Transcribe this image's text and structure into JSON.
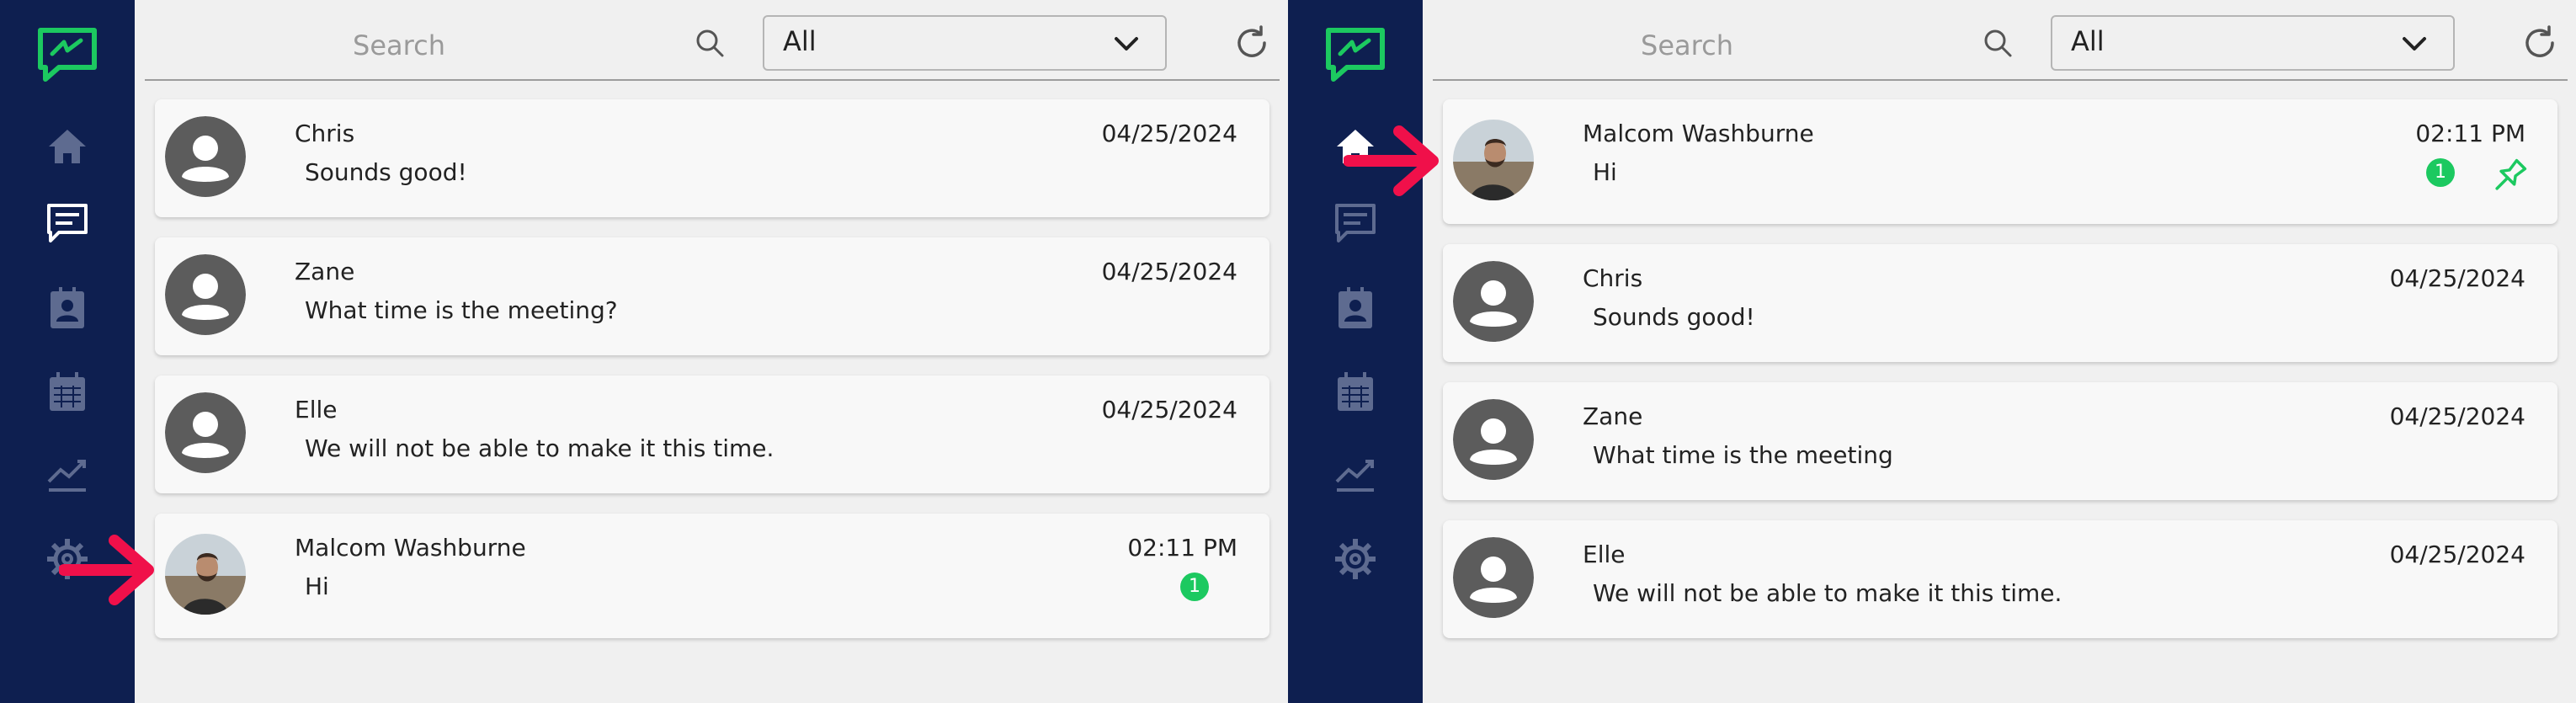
{
  "colors": {
    "sidebar": "#0e1f50",
    "accent_green": "#1cc960",
    "arrow_red": "#f0104a",
    "icon_gray": "#5e6b90",
    "active_white": "#ffffff"
  },
  "panels": [
    {
      "sidebar": {
        "logo": "chat-bolt-logo-icon",
        "items": [
          {
            "icon": "home-icon",
            "active": false
          },
          {
            "icon": "chat-icon",
            "active": true
          },
          {
            "icon": "contact-card-icon",
            "active": false
          },
          {
            "icon": "calendar-icon",
            "active": false
          },
          {
            "icon": "trend-chart-icon",
            "active": false
          },
          {
            "icon": "gear-icon",
            "active": false
          }
        ]
      },
      "search": {
        "placeholder": "Search"
      },
      "filter": {
        "value": "All"
      },
      "conversations": [
        {
          "name": "Chris",
          "preview": "Sounds good!",
          "time": "04/25/2024",
          "avatar": "default"
        },
        {
          "name": "Zane",
          "preview": "What time is the meeting?",
          "time": "04/25/2024",
          "avatar": "default"
        },
        {
          "name": "Elle",
          "preview": "We will not be able to make it this time.",
          "time": "04/25/2024",
          "avatar": "default"
        },
        {
          "name": "Malcom Washburne",
          "preview": "Hi",
          "time": "02:11 PM",
          "avatar": "photo",
          "unread": "1"
        }
      ]
    },
    {
      "sidebar": {
        "logo": "chat-bolt-logo-icon",
        "items": [
          {
            "icon": "home-icon",
            "active": true
          },
          {
            "icon": "chat-icon",
            "active": false
          },
          {
            "icon": "contact-card-icon",
            "active": false
          },
          {
            "icon": "calendar-icon",
            "active": false
          },
          {
            "icon": "trend-chart-icon",
            "active": false
          },
          {
            "icon": "gear-icon",
            "active": false
          }
        ]
      },
      "search": {
        "placeholder": "Search"
      },
      "filter": {
        "value": "All"
      },
      "conversations": [
        {
          "name": "Malcom Washburne",
          "preview": "Hi",
          "time": "02:11 PM",
          "avatar": "photo",
          "unread": "1",
          "pinned": true
        },
        {
          "name": "Chris",
          "preview": "Sounds good!",
          "time": "04/25/2024",
          "avatar": "default"
        },
        {
          "name": "Zane",
          "preview": "What time is the meeting",
          "time": "04/25/2024",
          "avatar": "default"
        },
        {
          "name": "Elle",
          "preview": "We will not be able to make it this time.",
          "time": "04/25/2024",
          "avatar": "default"
        }
      ]
    }
  ]
}
